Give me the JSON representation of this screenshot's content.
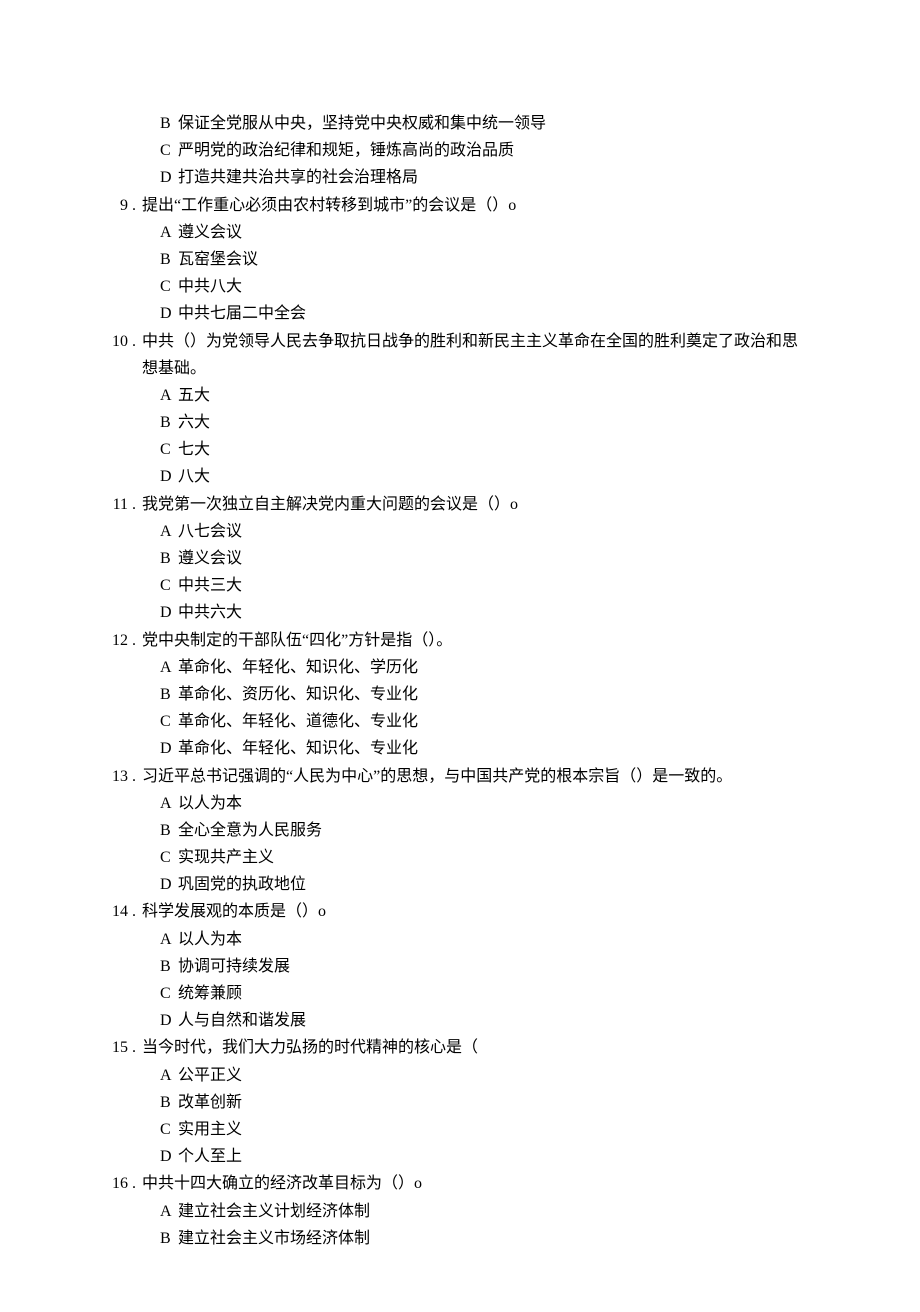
{
  "orphan8": {
    "B": "保证全党服从中央，坚持党中央权威和集中统一领导",
    "C": "严明党的政治纪律和规矩，锤炼高尚的政治品质",
    "D": "打造共建共治共享的社会治理格局"
  },
  "q9": {
    "num": "9 .",
    "stem": "提出“工作重心必须由农村转移到城市”的会议是（）o",
    "A": "遵义会议",
    "B": "瓦窑堡会议",
    "C": "中共八大",
    "D": "中共七届二中全会"
  },
  "q10": {
    "num": "10 .",
    "stem": "中共（）为党领导人民去争取抗日战争的胜利和新民主主义革命在全国的胜利奠定了政治和思想基础。",
    "A": "五大",
    "B": "六大",
    "C": "七大",
    "D": "八大"
  },
  "q11": {
    "num": "11 .",
    "stem": "我党第一次独立自主解决党内重大问题的会议是（）o",
    "A": "八七会议",
    "B": "遵义会议",
    "C": "中共三大",
    "D": "中共六大"
  },
  "q12": {
    "num": "12 .",
    "stem": "党中央制定的干部队伍“四化”方针是指（）。",
    "A": "革命化、年轻化、知识化、学历化",
    "B": "革命化、资历化、知识化、专业化",
    "C": "革命化、年轻化、道德化、专业化",
    "D": "革命化、年轻化、知识化、专业化"
  },
  "q13": {
    "num": "13 .",
    "stem": "习近平总书记强调的“人民为中心”的思想，与中国共产党的根本宗旨（）是一致的。",
    "A": "以人为本",
    "B": "全心全意为人民服务",
    "C": "实现共产主义",
    "D": "巩固党的执政地位"
  },
  "q14": {
    "num": "14 .",
    "stem": "科学发展观的本质是（）o",
    "A": "以人为本",
    "B": "协调可持续发展",
    "C": "统筹兼顾",
    "D": "人与自然和谐发展"
  },
  "q15": {
    "num": "15 .",
    "stem": "当今时代，我们大力弘扬的时代精神的核心是（",
    "A": "公平正义",
    "B": "改革创新",
    "C": "实用主义",
    "D": "个人至上"
  },
  "q16": {
    "num": "16 .",
    "stem": "中共十四大确立的经济改革目标为（）o",
    "A": "建立社会主义计划经济体制",
    "B": "建立社会主义市场经济体制"
  },
  "letters": {
    "A": "A ",
    "B": "B ",
    "C": "C ",
    "D": "D "
  }
}
